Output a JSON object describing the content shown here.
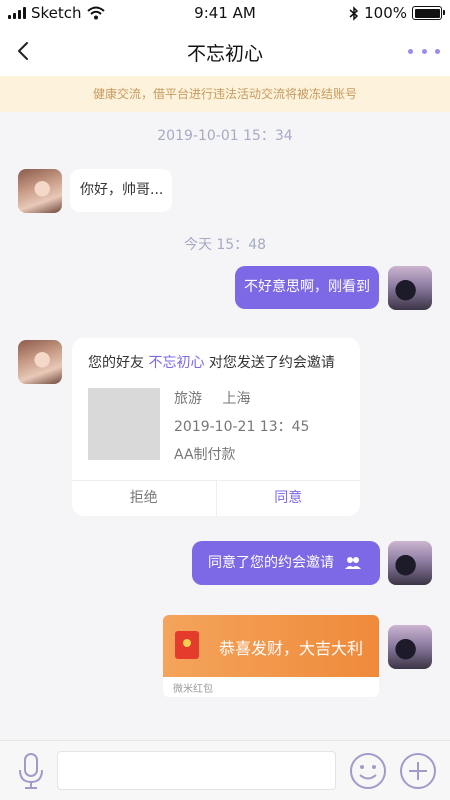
{
  "status_bar": {
    "carrier": "Sketch",
    "time": "9:41 AM",
    "battery_percent": "100%",
    "battery_level": 1.0
  },
  "nav": {
    "title": "不忘初心",
    "back_icon": "chevron-left-icon",
    "more_icon": "more-dots-icon"
  },
  "notice": {
    "text": "健康交流，借平台进行违法活动交流将被冻结账号"
  },
  "messages": {
    "time1": "2019-10-01 15：34",
    "msg1": "你好，帅哥...",
    "time2": "今天 15：48",
    "msg2": "不好意思啊，刚看到",
    "invite": {
      "prefix": "您的好友",
      "friend": "不忘初心",
      "suffix": "对您发送了约会邀请",
      "activity": "旅游",
      "city": "上海",
      "datetime": "2019-10-21   13：45",
      "payment": "AA制付款",
      "reject": "拒绝",
      "agree": "同意"
    },
    "msg3": "同意了您的约会邀请",
    "red_packet": {
      "text": "恭喜发财，大吉大利",
      "label": "微米红包"
    }
  },
  "input_bar": {
    "placeholder": "",
    "value": ""
  },
  "colors": {
    "accent": "#7d68e6",
    "notice_bg": "#fdf3dc",
    "notice_text": "#c69a5e",
    "red_packet": "#ef8a3a"
  }
}
